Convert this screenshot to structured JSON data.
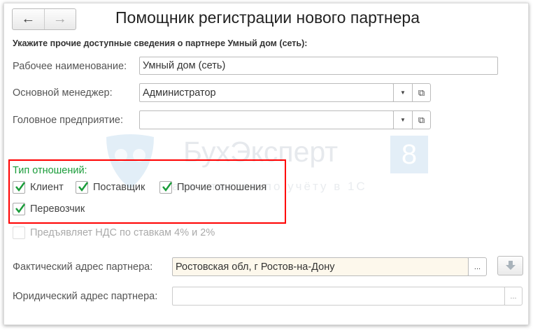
{
  "window": {
    "title": "Помощник регистрации нового партнера",
    "back_icon": "←",
    "forward_icon": "→"
  },
  "subtitle": "Укажите прочие доступные сведения о партнере Умный дом (сеть):",
  "fields": {
    "working_name": {
      "label": "Рабочее наименование:",
      "value": "Умный дом (сеть)"
    },
    "manager": {
      "label": "Основной менеджер:",
      "value": "Администратор"
    },
    "head_company": {
      "label": "Головное предприятие:",
      "value": ""
    }
  },
  "relations": {
    "label": "Тип отношений:",
    "items": [
      {
        "label": "Клиент",
        "checked": true
      },
      {
        "label": "Поставщик",
        "checked": true
      },
      {
        "label": "Прочие отношения",
        "checked": true
      },
      {
        "label": "Перевозчик",
        "checked": true
      }
    ]
  },
  "vat_checkbox": {
    "label": "Предъявляет НДС по ставкам 4% и 2%",
    "checked": false,
    "disabled": true
  },
  "actual_address": {
    "label": "Фактический адрес партнера:",
    "value": "Ростовская обл, г Ростов-на-Дону",
    "select_label": "..."
  },
  "legal_address": {
    "label": "Юридический адрес партнера:",
    "value": "",
    "select_label": "..."
  },
  "watermark": {
    "brand": "БухЭксперт",
    "badge": "8",
    "tagline": "База ответов по учёту в 1С"
  },
  "colors": {
    "accent_green": "#1a9c3a",
    "highlight": "#ff0000",
    "address_bg": "#fdf8ec"
  }
}
